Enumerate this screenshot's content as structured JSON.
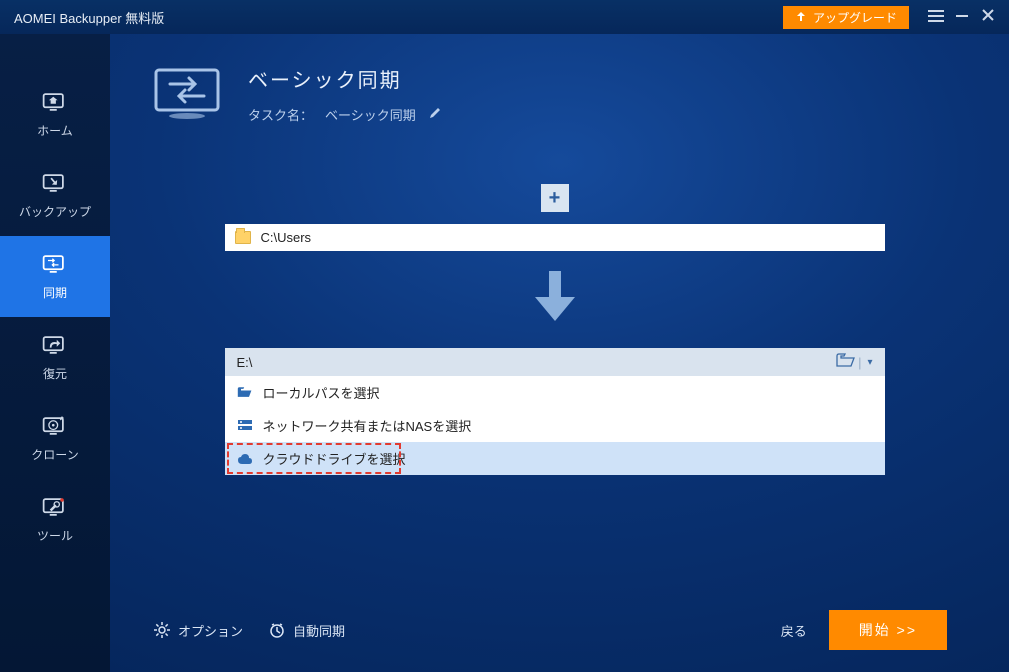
{
  "titlebar": {
    "app_title": "AOMEI Backupper 無料版",
    "upgrade_label": "アップグレード"
  },
  "sidebar": {
    "items": [
      {
        "label": "ホーム"
      },
      {
        "label": "バックアップ"
      },
      {
        "label": "同期"
      },
      {
        "label": "復元"
      },
      {
        "label": "クローン"
      },
      {
        "label": "ツール"
      }
    ]
  },
  "header": {
    "page_title": "ベーシック同期",
    "task_label": "タスク名：",
    "task_value": "ベーシック同期"
  },
  "source": {
    "path": "C:\\Users"
  },
  "destination": {
    "path": "E:\\",
    "menu": {
      "local": "ローカルパスを選択",
      "nas": "ネットワーク共有またはNASを選択",
      "cloud": "クラウドドライブを選択"
    }
  },
  "footer": {
    "options": "オプション",
    "schedule": "自動同期",
    "back": "戻る",
    "start": "開始 >>"
  }
}
